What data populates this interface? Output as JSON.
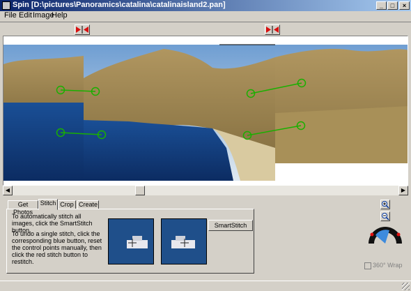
{
  "window": {
    "title": "Spin [D:\\pictures\\Panoramics\\catalina\\catalinaisland2.pan]",
    "controls": [
      "_",
      "□",
      "×"
    ]
  },
  "menu": [
    "File",
    "Edit",
    "Image",
    "Help"
  ],
  "toolbar": {
    "stitch_buttons": [
      "stitch-left",
      "stitch-right"
    ]
  },
  "tabs": [
    "Get Photos",
    "Stitch",
    "Crop",
    "Create"
  ],
  "active_tab": "Stitch",
  "stitch_panel": {
    "instructions_1": "To automatically stitch all images, click the SmartStitch button.",
    "instructions_2": "To undo a single stitch, click the corresponding blue button, reset the control points manually, then click the red stitch button to restitch.",
    "smartstitch_label": "SmartStitch"
  },
  "view_options": {
    "wrap_label": "360° Wrap",
    "wrap_checked": false
  },
  "colors": {
    "accent": "#0a246a",
    "control_point": "#19b000",
    "stitch_arrow": "#d81010"
  }
}
